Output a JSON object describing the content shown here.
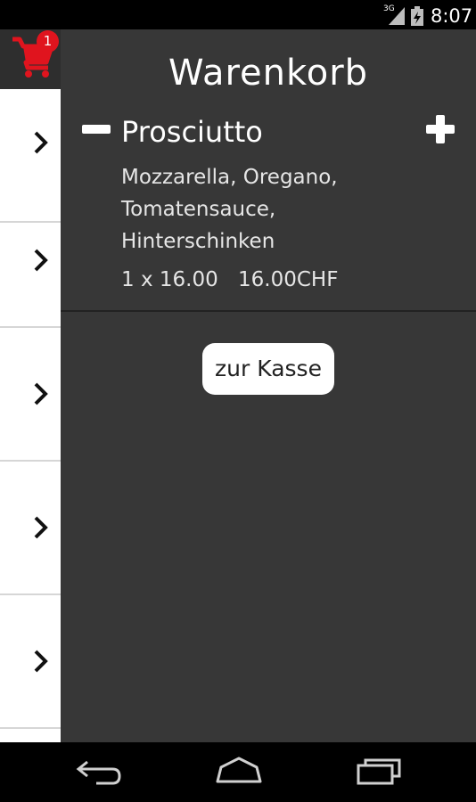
{
  "status_bar": {
    "network": "3G",
    "time": "8:07"
  },
  "cart": {
    "badge_count": "1",
    "accent_color": "#e0141e"
  },
  "drawer": {
    "title": "Warenkorb",
    "item": {
      "name": "Prosciutto",
      "description": "Mozzarella, Oregano, Tomatensauce, Hinterschinken",
      "quantity_price": "1 x 16.00",
      "total": "16.00CHF"
    },
    "checkout_label": "zur Kasse"
  },
  "icons": {
    "cart": "shopping-cart-icon",
    "minus": "minus-icon",
    "plus": "plus-icon",
    "chevron": "chevron-right-icon",
    "back": "back-icon",
    "home": "home-icon",
    "recents": "recent-apps-icon"
  }
}
